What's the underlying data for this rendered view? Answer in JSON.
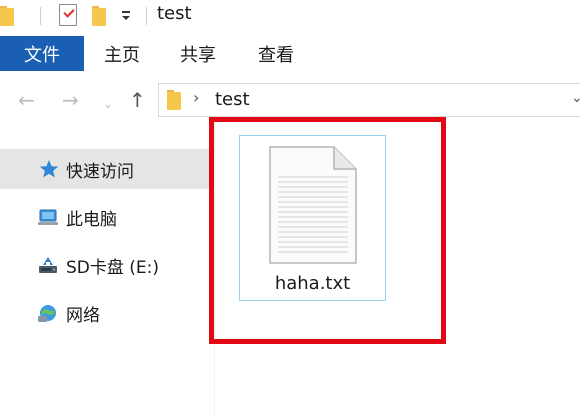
{
  "window": {
    "title": "test"
  },
  "quick_access_toolbar": {
    "icons": [
      "folder-icon",
      "properties-checkmark-icon",
      "new-folder-icon",
      "customize-dropdown-icon"
    ]
  },
  "ribbon": {
    "tabs": [
      {
        "label": "文件",
        "active": true
      },
      {
        "label": "主页"
      },
      {
        "label": "共享"
      },
      {
        "label": "查看"
      }
    ],
    "accent_color": "#1a5fb4"
  },
  "navigation": {
    "back_icon": "arrow-left-icon",
    "forward_icon": "arrow-right-icon",
    "recent_icon": "chevron-down-icon",
    "up_icon": "arrow-up-icon"
  },
  "address_bar": {
    "path": "test"
  },
  "sidebar": {
    "items": [
      {
        "label": "快速访问",
        "icon": "star-icon",
        "selected": true
      },
      {
        "label": "此电脑",
        "icon": "computer-icon"
      },
      {
        "label": "SD卡盘 (E:)",
        "icon": "drive-icon"
      },
      {
        "label": "网络",
        "icon": "network-icon"
      }
    ]
  },
  "content": {
    "files": [
      {
        "name": "haha.txt",
        "icon": "text-document-icon",
        "selected": true
      }
    ],
    "highlight_color": "#e30613"
  }
}
